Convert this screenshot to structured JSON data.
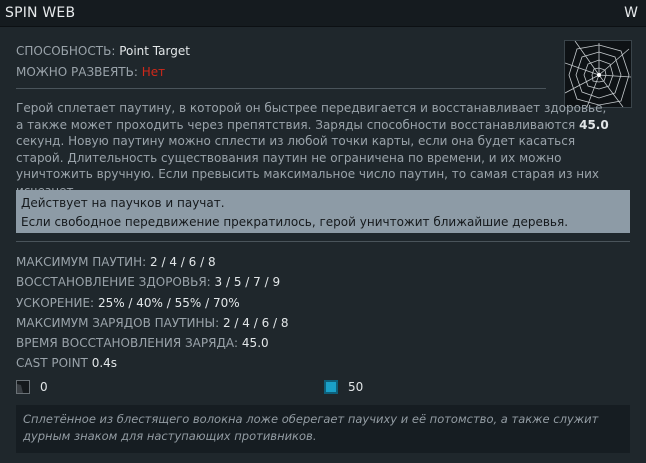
{
  "window": {
    "title": "SPIN WEB",
    "hotkey": "W"
  },
  "header": {
    "ability_label": "СПОСОБНОСТЬ:",
    "ability_value": "Point Target",
    "dispellable_label": "МОЖНО РАЗВЕЯТЬ:",
    "dispellable_value": "Нет"
  },
  "description": {
    "part1": "Герой сплетает паутину, в которой он быстрее передвигается и восстанавливает здоровье, а также может проходить через препятствия. Заряды способности восстанавливаются ",
    "highlight": "45.0",
    "part2": " секунд. Новую паутину можно сплести из любой точки карты, если она будет касаться старой. Длительность существования паутин не ограничена по времени, и их можно уничтожить вручную. Если превысить максимальное число паутин, то самая старая из них исчезнет."
  },
  "notes": [
    "Действует на паучков и паучат.",
    "Если свободное передвижение прекратилось, герой уничтожит ближайшие деревья."
  ],
  "stats": [
    {
      "label": "МАКСИМУМ ПАУТИН:",
      "value": "2 / 4 / 6 / 8"
    },
    {
      "label": "ВОССТАНОВЛЕНИЕ ЗДОРОВЬЯ:",
      "value": "3 / 5 / 7 / 9"
    },
    {
      "label": "УСКОРЕНИЕ:",
      "value": "25% / 40% / 55% / 70%"
    },
    {
      "label": "МАКСИМУМ ЗАРЯДОВ ПАУТИНЫ:",
      "value": "2 / 4 / 6 / 8"
    },
    {
      "label": "ВРЕМЯ ВОССТАНОВЛЕНИЯ ЗАРЯДА:",
      "value": "45.0"
    },
    {
      "label": "CAST POINT",
      "value": "0.4s"
    }
  ],
  "costs": {
    "cooldown": {
      "icon": "cooldown-icon",
      "value": "0",
      "color": "#2a2f33"
    },
    "mana": {
      "icon": "mana-icon",
      "value": "50",
      "color": "#1aa0c8"
    }
  },
  "lore": "Сплетённое из блестящего волокна ложе оберегает паучиху и её потомство, а также служит дурным знаком для наступающих противников.",
  "colors": {
    "accent_red": "#d0281a",
    "notes_bg": "#8d9ba6",
    "mana": "#1aa0c8"
  }
}
